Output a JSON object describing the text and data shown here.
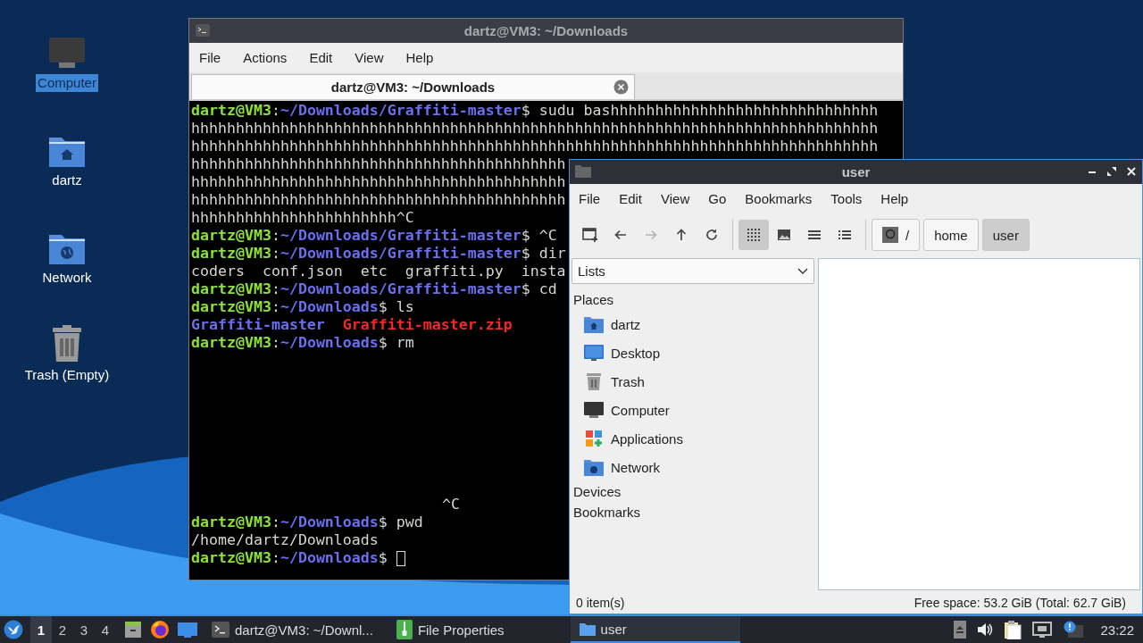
{
  "desktop_icons": [
    {
      "label": "Computer",
      "kind": "computer",
      "selected": true
    },
    {
      "label": "dartz",
      "kind": "home",
      "selected": false
    },
    {
      "label": "Network",
      "kind": "network",
      "selected": false
    },
    {
      "label": "Trash (Empty)",
      "kind": "trash",
      "selected": false
    }
  ],
  "terminal": {
    "title": "dartz@VM3: ~/Downloads",
    "menu": [
      "File",
      "Actions",
      "Edit",
      "View",
      "Help"
    ],
    "tabs": [
      {
        "label": "dartz@VM3: ~/Downloads",
        "selected": true
      }
    ],
    "lines": [
      {
        "kind": "normal",
        "segments": [
          {
            "kind": "user",
            "text": "dartz@VM3"
          },
          {
            "kind": "plain",
            "text": ":"
          },
          {
            "kind": "path",
            "text": "~/Downloads/Graffiti-master"
          },
          {
            "kind": "plain",
            "text": "$ sudu bashhhhhhhhhhhhhhhhhhhhhhhhhhhhhh"
          }
        ]
      },
      {
        "kind": "normal",
        "segments": [
          {
            "kind": "plain",
            "text": "hhhhhhhhhhhhhhhhhhhhhhhhhhhhhhhhhhhhhhhhhhhhhhhhhhhhhhhhhhhhhhhhhhhhhhhhhhhhh"
          }
        ]
      },
      {
        "kind": "normal",
        "segments": [
          {
            "kind": "plain",
            "text": "hhhhhhhhhhhhhhhhhhhhhhhhhhhhhhhhhhhhhhhhhhhhhhhhhhhhhhhhhhhhhhhhhhhhhhhhhhhhh"
          }
        ]
      },
      {
        "kind": "normal",
        "segments": [
          {
            "kind": "plain",
            "text": "hhhhhhhhhhhhhhhhhhhhhhhhhhhhhhhhhhhhhhhhhh"
          }
        ]
      },
      {
        "kind": "normal",
        "segments": [
          {
            "kind": "plain",
            "text": "hhhhhhhhhhhhhhhhhhhhhhhhhhhhhhhhhhhhhhhhhh"
          }
        ]
      },
      {
        "kind": "normal",
        "segments": [
          {
            "kind": "plain",
            "text": "hhhhhhhhhhhhhhhhhhhhhhhhhhhhhhhhhhhhhhhhhh"
          }
        ]
      },
      {
        "kind": "normal",
        "segments": [
          {
            "kind": "plain",
            "text": "hhhhhhhhhhhhhhhhhhhhhhh^C"
          }
        ]
      },
      {
        "kind": "normal",
        "segments": [
          {
            "kind": "user",
            "text": "dartz@VM3"
          },
          {
            "kind": "plain",
            "text": ":"
          },
          {
            "kind": "path",
            "text": "~/Downloads/Graffiti-master"
          },
          {
            "kind": "plain",
            "text": "$ ^C"
          }
        ]
      },
      {
        "kind": "normal",
        "segments": [
          {
            "kind": "user",
            "text": "dartz@VM3"
          },
          {
            "kind": "plain",
            "text": ":"
          },
          {
            "kind": "path",
            "text": "~/Downloads/Graffiti-master"
          },
          {
            "kind": "plain",
            "text": "$ dir"
          }
        ]
      },
      {
        "kind": "normal",
        "segments": [
          {
            "kind": "plain",
            "text": "coders  conf.json  etc  graffiti.py  insta"
          }
        ]
      },
      {
        "kind": "normal",
        "segments": [
          {
            "kind": "user",
            "text": "dartz@VM3"
          },
          {
            "kind": "plain",
            "text": ":"
          },
          {
            "kind": "path",
            "text": "~/Downloads/Graffiti-master"
          },
          {
            "kind": "plain",
            "text": "$ cd"
          }
        ]
      },
      {
        "kind": "normal",
        "segments": [
          {
            "kind": "user",
            "text": "dartz@VM3"
          },
          {
            "kind": "plain",
            "text": ":"
          },
          {
            "kind": "path",
            "text": "~/Downloads"
          },
          {
            "kind": "plain",
            "text": "$ ls"
          }
        ]
      },
      {
        "kind": "normal",
        "segments": [
          {
            "kind": "dir",
            "text": "Graffiti-master"
          },
          {
            "kind": "archive",
            "text": "Graffiti-master.zip"
          }
        ]
      },
      {
        "kind": "normal",
        "segments": [
          {
            "kind": "user",
            "text": "dartz@VM3"
          },
          {
            "kind": "plain",
            "text": ":"
          },
          {
            "kind": "path",
            "text": "~/Downloads"
          },
          {
            "kind": "plain",
            "text": "$ rm"
          }
        ]
      },
      {
        "kind": "interrupt",
        "segments": [
          {
            "kind": "plain",
            "text": "^C"
          }
        ]
      },
      {
        "kind": "normal",
        "segments": [
          {
            "kind": "user",
            "text": "dartz@VM3"
          },
          {
            "kind": "plain",
            "text": ":"
          },
          {
            "kind": "path",
            "text": "~/Downloads"
          },
          {
            "kind": "plain",
            "text": "$ pwd"
          }
        ]
      },
      {
        "kind": "normal",
        "segments": [
          {
            "kind": "plain",
            "text": "/home/dartz/Downloads"
          }
        ]
      },
      {
        "kind": "prompt",
        "segments": [
          {
            "kind": "user",
            "text": "dartz@VM3"
          },
          {
            "kind": "plain",
            "text": ":"
          },
          {
            "kind": "path",
            "text": "~/Downloads"
          },
          {
            "kind": "plain",
            "text": "$ "
          }
        ]
      }
    ]
  },
  "file_manager": {
    "title": "user",
    "menu": [
      "File",
      "Edit",
      "View",
      "Go",
      "Bookmarks",
      "Tools",
      "Help"
    ],
    "nav": [
      {
        "kind": "new-tab",
        "disabled": false
      },
      {
        "kind": "back",
        "disabled": false
      },
      {
        "kind": "forward",
        "disabled": true
      },
      {
        "kind": "up",
        "disabled": false
      },
      {
        "kind": "reload",
        "disabled": false
      }
    ],
    "view_modes": [
      {
        "kind": "icons",
        "selected": true
      },
      {
        "kind": "thumbnails",
        "selected": false
      },
      {
        "kind": "compact",
        "selected": false
      },
      {
        "kind": "details",
        "selected": false
      }
    ],
    "path": [
      {
        "label": "/",
        "kind": "root",
        "selected": false
      },
      {
        "label": "home",
        "kind": "folder",
        "selected": false
      },
      {
        "label": "user",
        "kind": "folder",
        "selected": true
      }
    ],
    "side_pane_mode": "Lists",
    "sections": [
      {
        "title": "Places",
        "items": [
          {
            "label": "dartz",
            "kind": "home"
          },
          {
            "label": "Desktop",
            "kind": "desktop"
          },
          {
            "label": "Trash",
            "kind": "trash"
          },
          {
            "label": "Computer",
            "kind": "computer"
          },
          {
            "label": "Applications",
            "kind": "applications"
          },
          {
            "label": "Network",
            "kind": "network"
          }
        ]
      },
      {
        "title": "Devices"
      },
      {
        "title": "Bookmarks"
      }
    ],
    "status_left": "0 item(s)",
    "status_right": "Free space: 53.2 GiB (Total: 62.7 GiB)"
  },
  "taskbar": {
    "workspaces": [
      {
        "label": "1",
        "selected": true
      },
      {
        "label": "2",
        "selected": false
      },
      {
        "label": "3",
        "selected": false
      },
      {
        "label": "4",
        "selected": false
      }
    ],
    "tasks": [
      {
        "label": "dartz@VM3: ~/Downl...",
        "kind": "terminal",
        "selected": false
      },
      {
        "label": "File Properties",
        "kind": "archive",
        "selected": false
      },
      {
        "label": "user",
        "kind": "folder",
        "selected": true
      }
    ],
    "clock": "23:22"
  }
}
